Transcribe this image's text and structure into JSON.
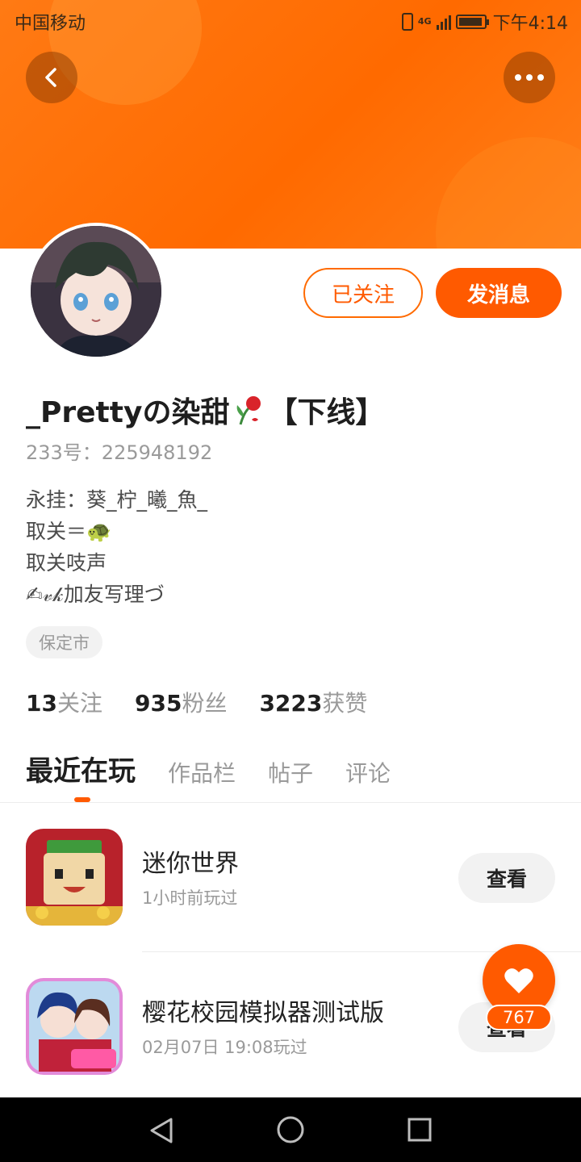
{
  "status_bar": {
    "carrier": "中国移动",
    "network": "4G",
    "time": "下午4:14"
  },
  "header": {
    "back_icon": "chevron-left-icon",
    "more_icon": "more-horizontal-icon"
  },
  "profile": {
    "follow_button": "已关注",
    "message_button": "发消息",
    "username": "_Prettyの染甜",
    "username_suffix": "【下线】",
    "uid": "233号：225948192",
    "bio": [
      "永挂：葵_柠_曦_魚_",
      "取关＝🐢",
      "取关吱声",
      "✍𝓋𝓀加友写理づ"
    ],
    "location": "保定市"
  },
  "stats": [
    {
      "num": "13",
      "label": "关注"
    },
    {
      "num": "935",
      "label": "粉丝"
    },
    {
      "num": "3223",
      "label": "获赞"
    }
  ],
  "tabs": [
    "最近在玩",
    "作品栏",
    "帖子",
    "评论"
  ],
  "games": [
    {
      "name": "迷你世界",
      "time": "1小时前玩过",
      "button": "查看"
    },
    {
      "name": "樱花校园模拟器测试版",
      "time": "02月07日 19:08玩过",
      "button": "查看"
    }
  ],
  "like": {
    "icon": "heart-icon",
    "count": "767"
  },
  "colors": {
    "accent": "#ff5a00",
    "banner": "#ff7a14"
  }
}
